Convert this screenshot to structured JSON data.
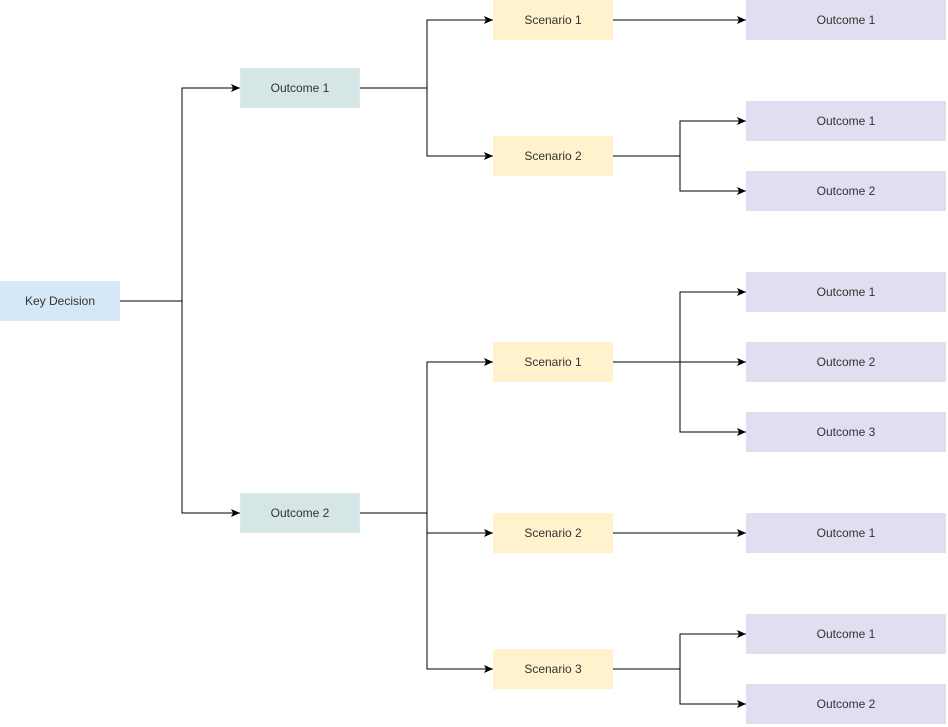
{
  "diagram": {
    "title": "",
    "colors": {
      "root_fill": "#d5e8f7",
      "outcome_fill": "#d6e5e6",
      "scenario_fill": "#fff2cc",
      "leaf_fill": "#e0def0",
      "edge": "#000000",
      "text": "#333333"
    },
    "root": {
      "label": "Key Decision"
    },
    "outcomes": [
      {
        "label": "Outcome 1",
        "scenarios": [
          {
            "label": "Scenario 1",
            "leaves": [
              {
                "label": "Outcome 1"
              }
            ]
          },
          {
            "label": "Scenario 2",
            "leaves": [
              {
                "label": "Outcome 1"
              },
              {
                "label": "Outcome 2"
              }
            ]
          }
        ]
      },
      {
        "label": "Outcome 2",
        "scenarios": [
          {
            "label": "Scenario 1",
            "leaves": [
              {
                "label": "Outcome 1"
              },
              {
                "label": "Outcome 2"
              },
              {
                "label": "Outcome 3"
              }
            ]
          },
          {
            "label": "Scenario 2",
            "leaves": [
              {
                "label": "Outcome 1"
              }
            ]
          },
          {
            "label": "Scenario 3",
            "leaves": [
              {
                "label": "Outcome 1"
              },
              {
                "label": "Outcome 2"
              }
            ]
          }
        ]
      }
    ]
  }
}
